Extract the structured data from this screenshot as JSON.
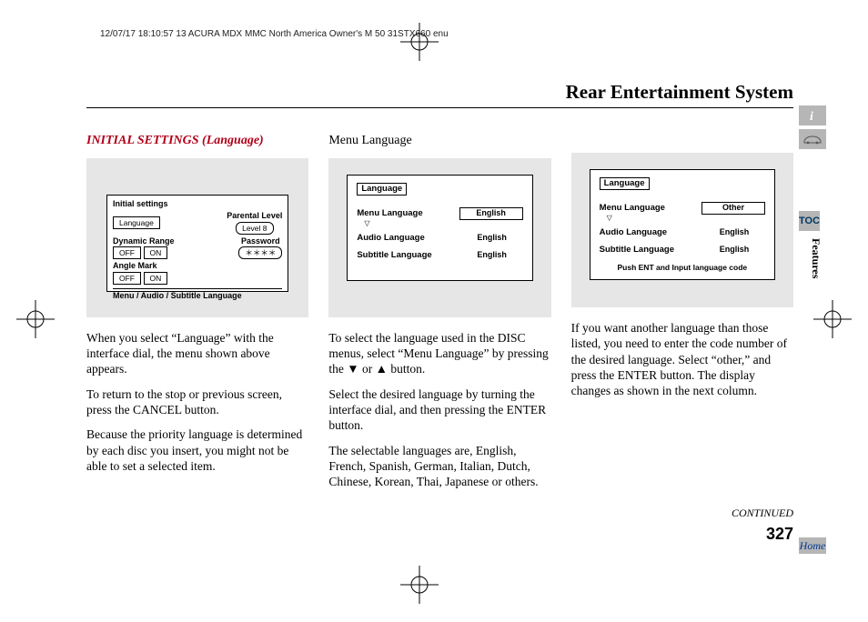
{
  "header": "12/07/17 18:10:57   13 ACURA MDX MMC North America Owner's M 50 31STX660 enu",
  "pageTitle": "Rear Entertainment System",
  "continued": "CONTINUED",
  "pageNumber": "327",
  "sideTabs": {
    "toc": "TOC",
    "features": "Features",
    "home": "Home"
  },
  "col1": {
    "heading": "INITIAL SETTINGS (Language)",
    "screen": {
      "title": "Initial settings",
      "rows": [
        {
          "left": "Language",
          "rightLabel": "Parental Level",
          "rightSub": "Level 8"
        },
        {
          "left": "Dynamic Range",
          "leftBtns": [
            "OFF",
            "ON"
          ],
          "rightLabel": "Password",
          "rightSub": "＊＊＊＊"
        },
        {
          "left": "Angle Mark",
          "leftBtns": [
            "OFF",
            "ON"
          ]
        }
      ],
      "footer": "Menu / Audio / Subtitle   Language"
    },
    "p1": "When you select “Language” with the interface dial, the menu shown above appears.",
    "p2": "To return to the stop or previous screen, press the CANCEL button.",
    "p3": "Because the priority language is determined by each disc you insert, you might not be able to set a selected item."
  },
  "col2": {
    "heading": "Menu Language",
    "screen": {
      "header": "Language",
      "rows": [
        {
          "label": "Menu Language",
          "value": "English",
          "boxed": true
        },
        {
          "label": "Audio Language",
          "value": "English",
          "boxed": false
        },
        {
          "label": "Subtitle Language",
          "value": "English",
          "boxed": false
        }
      ]
    },
    "p1a": "To select the language used in the DISC menus, select “Menu Language” by pressing the ",
    "p1b": " or ",
    "p1c": " button.",
    "p2": "Select the desired language by turning the interface dial, and then pressing the ENTER button.",
    "p3": "The selectable languages are, English, French, Spanish, German, Italian, Dutch, Chinese, Korean, Thai, Japanese or others."
  },
  "col3": {
    "screen": {
      "header": "Language",
      "rows": [
        {
          "label": "Menu Language",
          "value": "Other",
          "boxed": true
        },
        {
          "label": "Audio Language",
          "value": "English",
          "boxed": false
        },
        {
          "label": "Subtitle Language",
          "value": "English",
          "boxed": false
        }
      ],
      "footer": "Push ENT and Input language code"
    },
    "p1": "If you want another language than those listed, you need to enter the code number of the desired language. Select “other,” and press the ENTER button. The display changes as shown in the next column."
  }
}
